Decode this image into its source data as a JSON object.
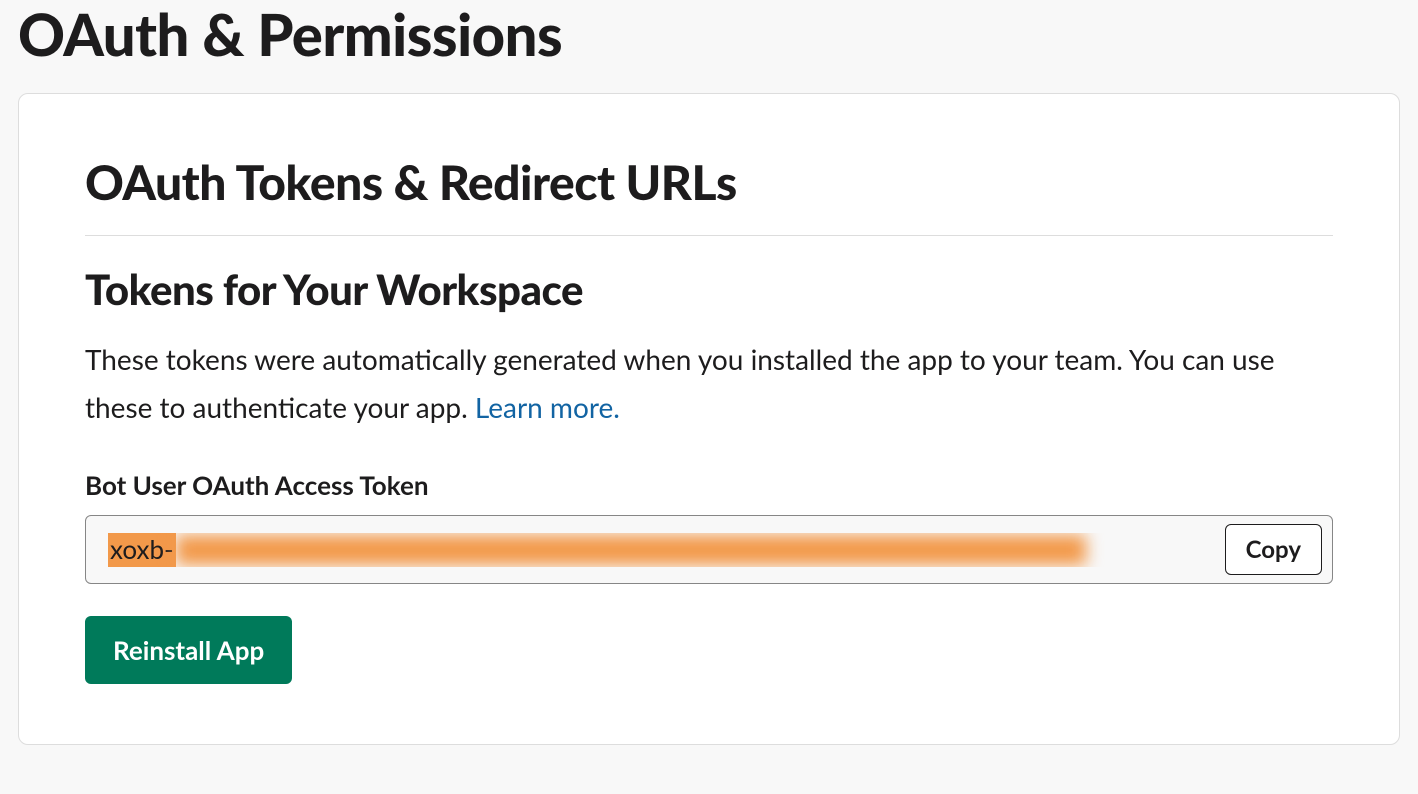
{
  "page": {
    "title": "OAuth & Permissions"
  },
  "card": {
    "section_title": "OAuth Tokens & Redirect URLs",
    "tokens": {
      "subsection_title": "Tokens for Your Workspace",
      "description_text": "These tokens were automatically generated when you installed the app to your team. You can use these to authenticate your app. ",
      "learn_more_label": "Learn more.",
      "bot_token": {
        "label": "Bot User OAuth Access Token",
        "value_prefix": "xoxb-",
        "copy_label": "Copy"
      },
      "reinstall_label": "Reinstall App"
    }
  }
}
